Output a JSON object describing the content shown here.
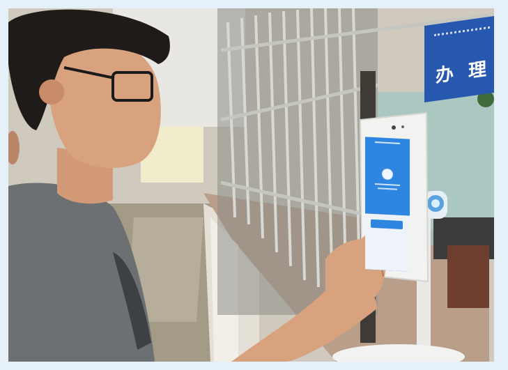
{
  "sign": {
    "text": "办 理"
  },
  "colors": {
    "frame_background": "#e6f0f8",
    "sign_blue": "#2758b0",
    "kiosk_screen_blue": "#2f86e0",
    "kiosk_body": "#f2f2f0",
    "shirt_gray": "#6d7073",
    "skin": "#d9a27f"
  }
}
